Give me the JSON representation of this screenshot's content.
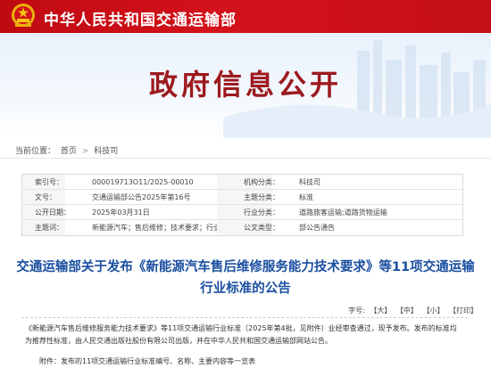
{
  "header": {
    "site_title": "中华人民共和国交通运输部",
    "colors": {
      "banner": "#c50f17",
      "hero_title": "#9c1a1f",
      "link_title": "#1a4fa0"
    }
  },
  "hero": {
    "title": "政府信息公开"
  },
  "breadcrumb": {
    "prefix": "当前位置：",
    "items": [
      "首页",
      "科技司"
    ],
    "separator": ">"
  },
  "meta": {
    "rows": [
      {
        "k1": "索引号：",
        "v1": "000019713O11/2025-00010",
        "k2": "机构分类：",
        "v2": "科技司"
      },
      {
        "k1": "文号：",
        "v1": "交通运输部公告2025年第16号",
        "k2": "主题分类：",
        "v2": "标准"
      },
      {
        "k1": "公开日期：",
        "v1": "2025年03月31日",
        "k2": "行业分类：",
        "v2": "道路旅客运输;道路货物运输"
      },
      {
        "k1": "主题词：",
        "v1": "新能源汽车；售后维修；技术要求；行业标准",
        "k2": "公文类型：",
        "v2": "部公告通告"
      }
    ]
  },
  "article": {
    "title": "交通运输部关于发布《新能源汽车售后维修服务能力技术要求》等11项交通运输行业标准的公告",
    "font_label": "字号:",
    "font_large": "【大】",
    "font_medium": "【中】",
    "font_small": "【小】",
    "print": "【打印】",
    "paragraph": "《新能源汽车售后维修服务能力技术要求》等11项交通运输行业标准（2025年第4批，见附件）业经审查通过，现予发布。发布的标准均为推荐性标准，由人民交通出版社股份有限公司出版，并在中华人民共和国交通运输部网站公告。",
    "attachment": "附件：发布的11项交通运输行业标准编号、名称、主要内容等一览表"
  }
}
